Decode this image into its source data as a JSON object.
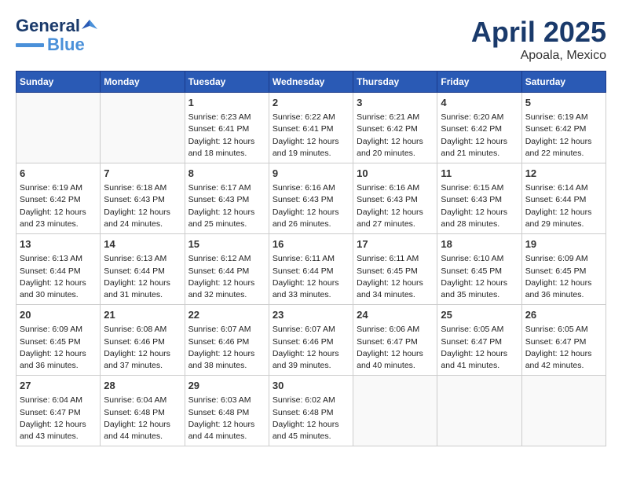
{
  "logo": {
    "line1": "General",
    "line2": "Blue"
  },
  "title": "April 2025",
  "subtitle": "Apoala, Mexico",
  "days_of_week": [
    "Sunday",
    "Monday",
    "Tuesday",
    "Wednesday",
    "Thursday",
    "Friday",
    "Saturday"
  ],
  "weeks": [
    [
      {
        "day": "",
        "info": ""
      },
      {
        "day": "",
        "info": ""
      },
      {
        "day": "1",
        "info": "Sunrise: 6:23 AM\nSunset: 6:41 PM\nDaylight: 12 hours\nand 18 minutes."
      },
      {
        "day": "2",
        "info": "Sunrise: 6:22 AM\nSunset: 6:41 PM\nDaylight: 12 hours\nand 19 minutes."
      },
      {
        "day": "3",
        "info": "Sunrise: 6:21 AM\nSunset: 6:42 PM\nDaylight: 12 hours\nand 20 minutes."
      },
      {
        "day": "4",
        "info": "Sunrise: 6:20 AM\nSunset: 6:42 PM\nDaylight: 12 hours\nand 21 minutes."
      },
      {
        "day": "5",
        "info": "Sunrise: 6:19 AM\nSunset: 6:42 PM\nDaylight: 12 hours\nand 22 minutes."
      }
    ],
    [
      {
        "day": "6",
        "info": "Sunrise: 6:19 AM\nSunset: 6:42 PM\nDaylight: 12 hours\nand 23 minutes."
      },
      {
        "day": "7",
        "info": "Sunrise: 6:18 AM\nSunset: 6:43 PM\nDaylight: 12 hours\nand 24 minutes."
      },
      {
        "day": "8",
        "info": "Sunrise: 6:17 AM\nSunset: 6:43 PM\nDaylight: 12 hours\nand 25 minutes."
      },
      {
        "day": "9",
        "info": "Sunrise: 6:16 AM\nSunset: 6:43 PM\nDaylight: 12 hours\nand 26 minutes."
      },
      {
        "day": "10",
        "info": "Sunrise: 6:16 AM\nSunset: 6:43 PM\nDaylight: 12 hours\nand 27 minutes."
      },
      {
        "day": "11",
        "info": "Sunrise: 6:15 AM\nSunset: 6:43 PM\nDaylight: 12 hours\nand 28 minutes."
      },
      {
        "day": "12",
        "info": "Sunrise: 6:14 AM\nSunset: 6:44 PM\nDaylight: 12 hours\nand 29 minutes."
      }
    ],
    [
      {
        "day": "13",
        "info": "Sunrise: 6:13 AM\nSunset: 6:44 PM\nDaylight: 12 hours\nand 30 minutes."
      },
      {
        "day": "14",
        "info": "Sunrise: 6:13 AM\nSunset: 6:44 PM\nDaylight: 12 hours\nand 31 minutes."
      },
      {
        "day": "15",
        "info": "Sunrise: 6:12 AM\nSunset: 6:44 PM\nDaylight: 12 hours\nand 32 minutes."
      },
      {
        "day": "16",
        "info": "Sunrise: 6:11 AM\nSunset: 6:44 PM\nDaylight: 12 hours\nand 33 minutes."
      },
      {
        "day": "17",
        "info": "Sunrise: 6:11 AM\nSunset: 6:45 PM\nDaylight: 12 hours\nand 34 minutes."
      },
      {
        "day": "18",
        "info": "Sunrise: 6:10 AM\nSunset: 6:45 PM\nDaylight: 12 hours\nand 35 minutes."
      },
      {
        "day": "19",
        "info": "Sunrise: 6:09 AM\nSunset: 6:45 PM\nDaylight: 12 hours\nand 36 minutes."
      }
    ],
    [
      {
        "day": "20",
        "info": "Sunrise: 6:09 AM\nSunset: 6:45 PM\nDaylight: 12 hours\nand 36 minutes."
      },
      {
        "day": "21",
        "info": "Sunrise: 6:08 AM\nSunset: 6:46 PM\nDaylight: 12 hours\nand 37 minutes."
      },
      {
        "day": "22",
        "info": "Sunrise: 6:07 AM\nSunset: 6:46 PM\nDaylight: 12 hours\nand 38 minutes."
      },
      {
        "day": "23",
        "info": "Sunrise: 6:07 AM\nSunset: 6:46 PM\nDaylight: 12 hours\nand 39 minutes."
      },
      {
        "day": "24",
        "info": "Sunrise: 6:06 AM\nSunset: 6:47 PM\nDaylight: 12 hours\nand 40 minutes."
      },
      {
        "day": "25",
        "info": "Sunrise: 6:05 AM\nSunset: 6:47 PM\nDaylight: 12 hours\nand 41 minutes."
      },
      {
        "day": "26",
        "info": "Sunrise: 6:05 AM\nSunset: 6:47 PM\nDaylight: 12 hours\nand 42 minutes."
      }
    ],
    [
      {
        "day": "27",
        "info": "Sunrise: 6:04 AM\nSunset: 6:47 PM\nDaylight: 12 hours\nand 43 minutes."
      },
      {
        "day": "28",
        "info": "Sunrise: 6:04 AM\nSunset: 6:48 PM\nDaylight: 12 hours\nand 44 minutes."
      },
      {
        "day": "29",
        "info": "Sunrise: 6:03 AM\nSunset: 6:48 PM\nDaylight: 12 hours\nand 44 minutes."
      },
      {
        "day": "30",
        "info": "Sunrise: 6:02 AM\nSunset: 6:48 PM\nDaylight: 12 hours\nand 45 minutes."
      },
      {
        "day": "",
        "info": ""
      },
      {
        "day": "",
        "info": ""
      },
      {
        "day": "",
        "info": ""
      }
    ]
  ]
}
